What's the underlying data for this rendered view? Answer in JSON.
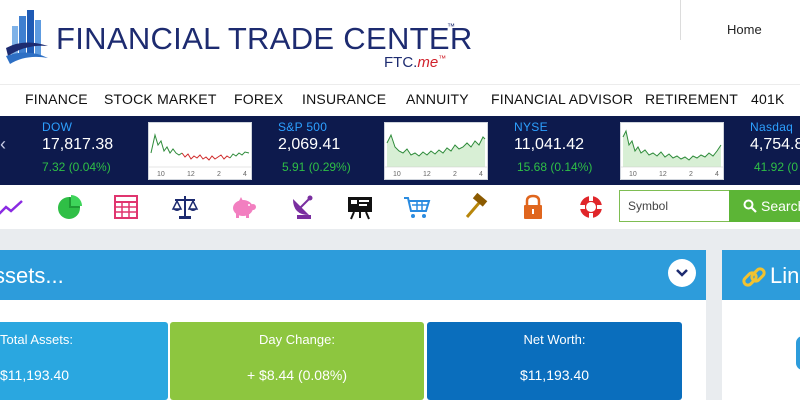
{
  "header": {
    "logo_title": "FINANCIAL TRADE CENTER",
    "logo_tm": "™",
    "logo_sub_main": "FTC.",
    "logo_sub_accent": "me",
    "logo_sub_tm": "™",
    "nav_home": "Home"
  },
  "menu": {
    "items": [
      "FINANCE",
      "STOCK MARKET",
      "FOREX",
      "INSURANCE",
      "ANNUITY",
      "FINANCIAL ADVISOR",
      "RETIREMENT",
      "401K"
    ]
  },
  "ticker": {
    "prev_arrow": "‹",
    "items": [
      {
        "name": "DOW",
        "value": "17,817.38",
        "change": "7.32  (0.04%)",
        "chart_ticks": [
          "10",
          "12",
          "2",
          "4"
        ]
      },
      {
        "name": "S&P 500",
        "value": "2,069.41",
        "change": "5.91  (0.29%)",
        "chart_ticks": [
          "10",
          "12",
          "2",
          "4"
        ]
      },
      {
        "name": "NYSE",
        "value": "11,041.42",
        "change": "15.68  (0.14%)",
        "chart_ticks": [
          "10",
          "12",
          "2",
          "4"
        ]
      },
      {
        "name": "Nasdaq",
        "value": "4,754.8",
        "change": "41.92  (0"
      }
    ]
  },
  "toolbar": {
    "icons": [
      "line-chart-icon",
      "pie-chart-icon",
      "calculator-grid-icon",
      "scales-icon",
      "piggy-bank-icon",
      "satellite-dish-icon",
      "presentation-board-icon",
      "shopping-cart-icon",
      "hammer-icon",
      "lock-icon",
      "lifebuoy-icon"
    ],
    "symbol_placeholder": "Symbol",
    "search_label": "Search"
  },
  "assets": {
    "title": "ssets...",
    "cards": [
      {
        "label": "Total Assets:",
        "value": "$11,193.40",
        "color": "#2aa7e0"
      },
      {
        "label": "Day Change:",
        "value": "+ $8.44 (0.08%)",
        "color": "#8dc63f"
      },
      {
        "label": "Net Worth:",
        "value": "$11,193.40",
        "color": "#0a6ebd"
      }
    ]
  },
  "links": {
    "title": "Link"
  },
  "colors": {
    "brand_navy": "#1d2b70",
    "ticker_bg": "#0d1a4d",
    "ticker_name": "#2da0ff",
    "ticker_change": "#2fbf46",
    "panel_header": "#2d9cdb",
    "search_green": "#5cb536"
  }
}
